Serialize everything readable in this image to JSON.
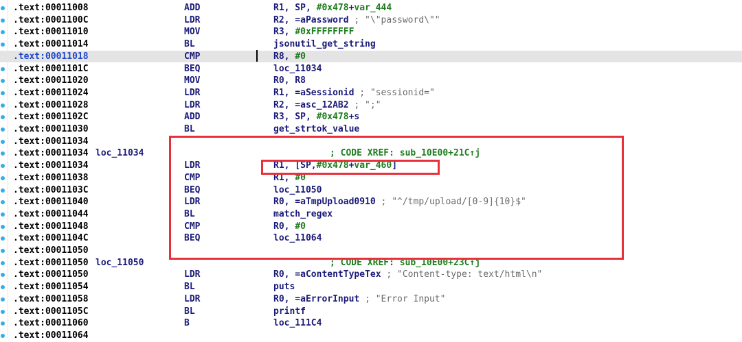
{
  "rows": [
    {
      "addr": ".text:00011008",
      "label": "",
      "mn": "ADD",
      "op": [
        "R1, SP, ",
        {
          "t": "#0x478",
          "c": "hex"
        },
        {
          "t": "+",
          "c": ""
        },
        {
          "t": "var_444",
          "c": "var"
        }
      ],
      "cmt": ""
    },
    {
      "addr": ".text:0001100C",
      "label": "",
      "mn": "LDR",
      "op": [
        "R2, =aPassword "
      ],
      "cmt": "; \"\\\"password\\\"\""
    },
    {
      "addr": ".text:00011010",
      "label": "",
      "mn": "MOV",
      "op": [
        "R3, ",
        {
          "t": "#0xFFFFFFFF",
          "c": "hex"
        }
      ],
      "cmt": ""
    },
    {
      "addr": ".text:00011014",
      "label": "",
      "mn": "BL",
      "op": [
        "jsonutil_get_string"
      ],
      "cmt": ""
    },
    {
      "addr": ".text:00011018",
      "label": "",
      "mn": "CMP",
      "op": [
        "R8, ",
        {
          "t": "#0",
          "c": "hex"
        }
      ],
      "cmt": "",
      "hl": true
    },
    {
      "addr": ".text:0001101C",
      "label": "",
      "mn": "BEQ",
      "op": [
        "loc_11034"
      ],
      "cmt": ""
    },
    {
      "addr": ".text:00011020",
      "label": "",
      "mn": "MOV",
      "op": [
        "R0, R8"
      ],
      "cmt": ""
    },
    {
      "addr": ".text:00011024",
      "label": "",
      "mn": "LDR",
      "op": [
        "R1, =aSessionid "
      ],
      "cmt": "; \"sessionid=\""
    },
    {
      "addr": ".text:00011028",
      "label": "",
      "mn": "LDR",
      "op": [
        "R2, =asc_12AB2 "
      ],
      "cmt": "; \";\""
    },
    {
      "addr": ".text:0001102C",
      "label": "",
      "mn": "ADD",
      "op": [
        "R3, SP, ",
        {
          "t": "#0x478",
          "c": "hex"
        },
        {
          "t": "+s",
          "c": ""
        }
      ],
      "cmt": ""
    },
    {
      "addr": ".text:00011030",
      "label": "",
      "mn": "BL",
      "op": [
        "get_strtok_value"
      ],
      "cmt": ""
    },
    {
      "addr": ".text:00011034",
      "label": "",
      "mn": "",
      "op": [],
      "cmt": ""
    },
    {
      "addr": ".text:00011034",
      "label": "loc_11034",
      "mn": "",
      "op": [],
      "cmt": "",
      "xref": "; CODE XREF: sub_10E00+21C↑j"
    },
    {
      "addr": ".text:00011034",
      "label": "",
      "mn": "LDR",
      "op": [
        "R1, [SP,",
        {
          "t": "#0x478",
          "c": "hex"
        },
        {
          "t": "+",
          "c": ""
        },
        {
          "t": "var_460",
          "c": "var"
        },
        {
          "t": "]",
          "c": ""
        }
      ],
      "cmt": ""
    },
    {
      "addr": ".text:00011038",
      "label": "",
      "mn": "CMP",
      "op": [
        "R1, ",
        {
          "t": "#0",
          "c": "hex"
        }
      ],
      "cmt": ""
    },
    {
      "addr": ".text:0001103C",
      "label": "",
      "mn": "BEQ",
      "op": [
        "loc_11050"
      ],
      "cmt": ""
    },
    {
      "addr": ".text:00011040",
      "label": "",
      "mn": "LDR",
      "op": [
        "R0, =aTmpUpload0910 "
      ],
      "cmt": "; \"^/tmp/upload/[0-9]{10}$\""
    },
    {
      "addr": ".text:00011044",
      "label": "",
      "mn": "BL",
      "op": [
        "match_regex"
      ],
      "cmt": ""
    },
    {
      "addr": ".text:00011048",
      "label": "",
      "mn": "CMP",
      "op": [
        "R0, ",
        {
          "t": "#0",
          "c": "hex"
        }
      ],
      "cmt": ""
    },
    {
      "addr": ".text:0001104C",
      "label": "",
      "mn": "BEQ",
      "op": [
        "loc_11064"
      ],
      "cmt": ""
    },
    {
      "addr": ".text:00011050",
      "label": "",
      "mn": "",
      "op": [],
      "cmt": ""
    },
    {
      "addr": ".text:00011050",
      "label": "loc_11050",
      "mn": "",
      "op": [],
      "cmt": "",
      "xref": "; CODE XREF: sub_10E00+23C↑j"
    },
    {
      "addr": ".text:00011050",
      "label": "",
      "mn": "LDR",
      "op": [
        "R0, =aContentTypeTex "
      ],
      "cmt": "; \"Content-type: text/html\\n\""
    },
    {
      "addr": ".text:00011054",
      "label": "",
      "mn": "BL",
      "op": [
        "puts"
      ],
      "cmt": ""
    },
    {
      "addr": ".text:00011058",
      "label": "",
      "mn": "LDR",
      "op": [
        "R0, =aErrorInput "
      ],
      "cmt": "; \"Error Input\""
    },
    {
      "addr": ".text:0001105C",
      "label": "",
      "mn": "BL",
      "op": [
        "printf"
      ],
      "cmt": ""
    },
    {
      "addr": ".text:00011060",
      "label": "",
      "mn": "B",
      "op": [
        "loc_111C4"
      ],
      "cmt": ""
    },
    {
      "addr": ".text:00011064",
      "label": "",
      "mn": "",
      "op": [],
      "cmt": ""
    }
  ],
  "colors": {
    "highlight_row": "#e4e4e4",
    "annotation_box": "#e8303a",
    "gutter_dot": "#33aee8",
    "hex_literal": "#1e7d1e",
    "instruction": "#1a1a7a"
  }
}
